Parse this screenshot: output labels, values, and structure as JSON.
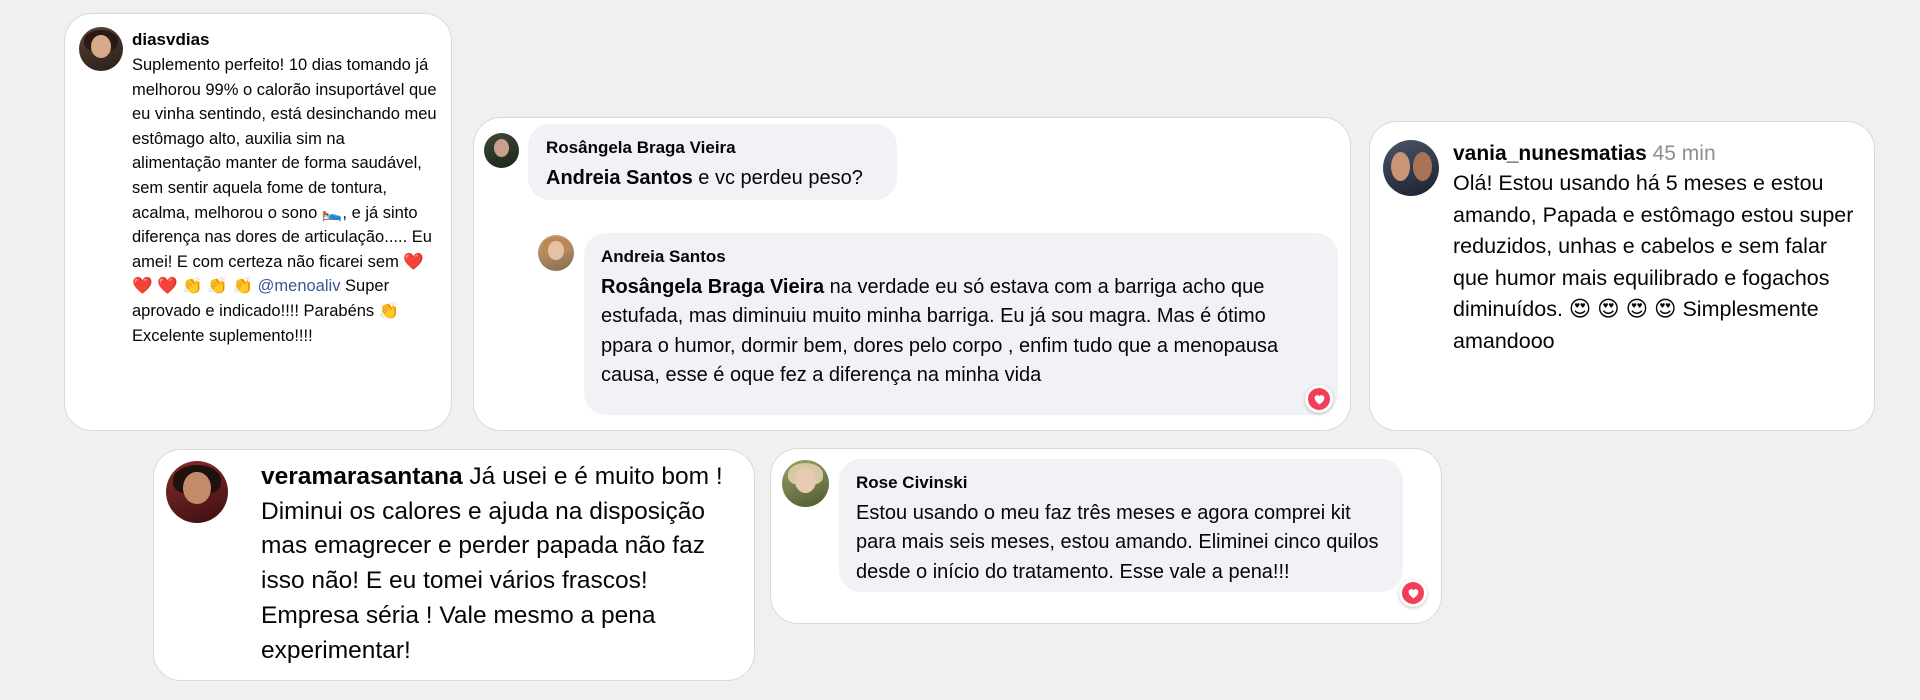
{
  "comments": {
    "c1": {
      "username": "diasvdias",
      "text_before": "Suplemento perfeito! 10 dias tomando já melhorou 99% o calorão insuportável que eu vinha sentindo, está desinchando meu estômago alto, auxilia sim na alimentação manter de forma saudável, sem sentir aquela fome de tontura, acalma, melhorou o sono 🛌, e já sinto diferença nas dores de articulação..... Eu amei! E com certeza não ficarei sem ❤️ ❤️ ❤️ 👏 👏 👏 ",
      "mention": "@menoaliv",
      "text_after": " Super aprovado e indicado!!!! Parabéns 👏 Excelente suplemento!!!!"
    },
    "c2": {
      "author": "Rosângela Braga Vieira",
      "mention": "Andreia Santos",
      "text": " e vc perdeu peso?",
      "reply": {
        "author": "Andreia Santos",
        "mention": "Rosângela Braga Vieira",
        "text": " na verdade eu só estava com a barriga acho que estufada, mas diminuiu muito minha barriga. Eu já sou magra. Mas é ótimo ppara o humor, dormir bem, dores pelo corpo , enfim tudo que a menopausa causa, esse é oque fez a diferença na minha vida"
      }
    },
    "c3": {
      "username": "vania_nunesmatias",
      "time": "45 min",
      "text": "Olá! Estou usando há 5 meses e estou amando, Papada e estômago estou super reduzidos, unhas e cabelos e sem falar que humor mais equilibrado e fogachos diminuídos. 😍 😍 😍 😍 Simplesmente amandooo"
    },
    "c4": {
      "username": "veramarasantana",
      "text": "Já usei e é muito bom ! Diminui os calores e ajuda na disposição mas emagrecer e perder papada não faz isso não! E eu tomei vários frascos! Empresa séria ! Vale mesmo a pena experimentar!"
    },
    "c5": {
      "author": "Rose Civinski",
      "text": "Estou usando o meu faz três meses e agora comprei kit para mais seis meses, estou amando. Eliminei cinco quilos desde o início do tratamento. Esse vale a pena!!!"
    }
  },
  "icons": {
    "reaction": "heart-reaction-icon"
  },
  "colors": {
    "heart": "#f33e58",
    "bubble": "#f0f2f5",
    "mention_link": "#385898"
  }
}
